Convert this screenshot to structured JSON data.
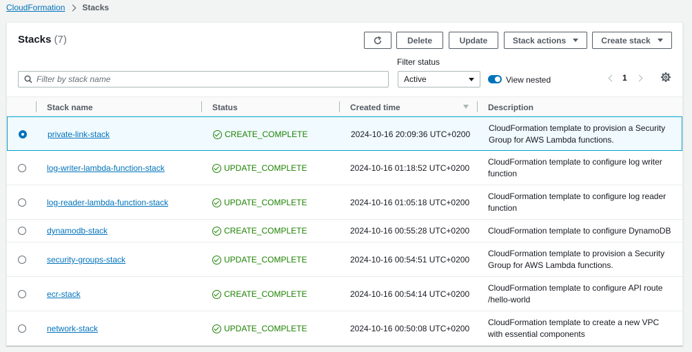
{
  "breadcrumb": {
    "parent": "CloudFormation",
    "current": "Stacks"
  },
  "panel": {
    "title": "Stacks",
    "count": "(7)"
  },
  "toolbar": {
    "refresh_icon": "refresh-icon",
    "delete_label": "Delete",
    "update_label": "Update",
    "stack_actions_label": "Stack actions",
    "create_stack_label": "Create stack"
  },
  "search": {
    "placeholder": "Filter by stack name"
  },
  "filter": {
    "label": "Filter status",
    "value": "Active"
  },
  "toggle": {
    "label": "View nested",
    "on": true
  },
  "pagination": {
    "page": "1"
  },
  "columns": {
    "name": "Stack name",
    "status": "Status",
    "created": "Created time",
    "description": "Description"
  },
  "rows": [
    {
      "name": "private-link-stack",
      "status": "CREATE_COMPLETE",
      "created": "2024-10-16 20:09:36 UTC+0200",
      "description": "CloudFormation template to provision a Security Group for AWS Lambda functions.",
      "selected": true
    },
    {
      "name": "log-writer-lambda-function-stack",
      "status": "UPDATE_COMPLETE",
      "created": "2024-10-16 01:18:52 UTC+0200",
      "description": "CloudFormation template to configure log writer function",
      "selected": false
    },
    {
      "name": "log-reader-lambda-function-stack",
      "status": "UPDATE_COMPLETE",
      "created": "2024-10-16 01:05:18 UTC+0200",
      "description": "CloudFormation template to configure log reader function",
      "selected": false
    },
    {
      "name": "dynamodb-stack",
      "status": "CREATE_COMPLETE",
      "created": "2024-10-16 00:55:28 UTC+0200",
      "description": "CloudFormation template to configure DynamoDB",
      "selected": false
    },
    {
      "name": "security-groups-stack",
      "status": "UPDATE_COMPLETE",
      "created": "2024-10-16 00:54:51 UTC+0200",
      "description": "CloudFormation template to provision a Security Group for AWS Lambda functions.",
      "selected": false
    },
    {
      "name": "ecr-stack",
      "status": "CREATE_COMPLETE",
      "created": "2024-10-16 00:54:14 UTC+0200",
      "description": "CloudFormation template to configure API route /hello-world",
      "selected": false
    },
    {
      "name": "network-stack",
      "status": "UPDATE_COMPLETE",
      "created": "2024-10-16 00:50:08 UTC+0200",
      "description": "CloudFormation template to create a new VPC with essential components",
      "selected": false
    }
  ],
  "colors": {
    "link": "#0073bb",
    "success": "#1d8102",
    "selected_border": "#00a1c9"
  }
}
